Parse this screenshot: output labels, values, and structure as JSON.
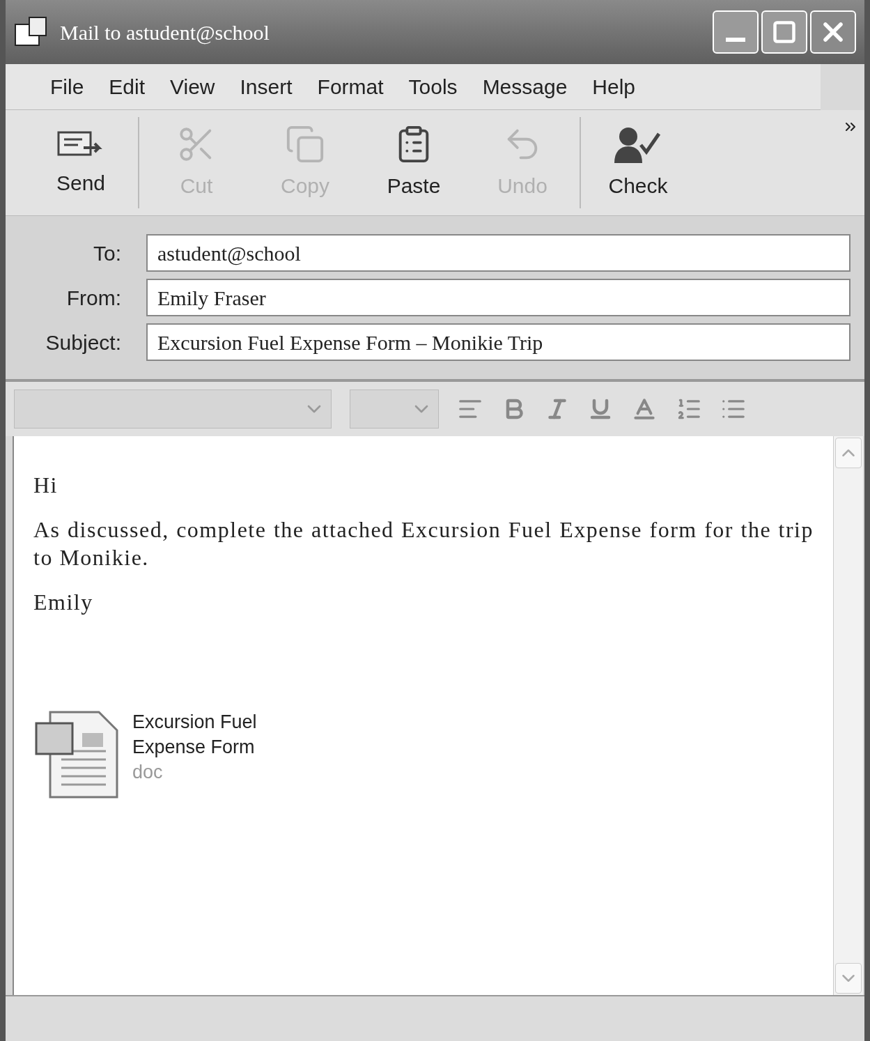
{
  "window": {
    "title": "Mail to astudent@school"
  },
  "menu": [
    "File",
    "Edit",
    "View",
    "Insert",
    "Format",
    "Tools",
    "Message",
    "Help"
  ],
  "toolbar": [
    {
      "label": "Send",
      "kind": "send",
      "disabled": false
    },
    {
      "label": "Cut",
      "kind": "cut",
      "disabled": true
    },
    {
      "label": "Copy",
      "kind": "copy",
      "disabled": true
    },
    {
      "label": "Paste",
      "kind": "paste",
      "disabled": false
    },
    {
      "label": "Undo",
      "kind": "undo",
      "disabled": true
    },
    {
      "label": "Check",
      "kind": "check",
      "disabled": false
    }
  ],
  "fields": [
    {
      "label": "To:",
      "value": "astudent@school"
    },
    {
      "label": "From:",
      "value": "Emily Fraser"
    },
    {
      "label": "Subject:",
      "value": "Excursion Fuel Expense Form – Monikie Trip"
    }
  ],
  "body": {
    "paragraphs": [
      "Hi",
      "As discussed, complete the attached Excursion Fuel Expense form for the trip to Monikie.",
      "Emily"
    ]
  },
  "attachment": {
    "name": "Excursion Fuel Expense Form",
    "type": "doc"
  }
}
